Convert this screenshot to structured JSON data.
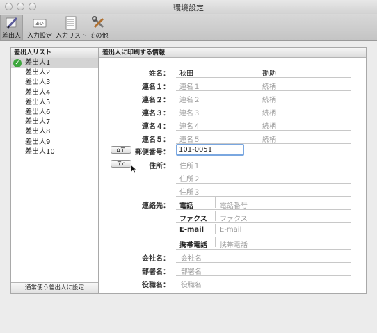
{
  "window": {
    "title": "環境設定"
  },
  "toolbar": {
    "items": [
      {
        "label": "差出人",
        "icon": "pen-icon"
      },
      {
        "label": "入力設定",
        "icon": "keyboard-icon"
      },
      {
        "label": "入力リスト",
        "icon": "list-icon"
      },
      {
        "label": "その他",
        "icon": "tools-icon"
      }
    ]
  },
  "sender_list": {
    "header": "差出人リスト",
    "items": [
      "差出人1",
      "差出人2",
      "差出人3",
      "差出人4",
      "差出人5",
      "差出人6",
      "差出人7",
      "差出人8",
      "差出人9",
      "差出人10"
    ],
    "selected_index": 0,
    "set_default_label": "通常使う差出人に設定"
  },
  "details": {
    "header": "差出人に印刷する情報",
    "name": {
      "label": "姓名：",
      "last": "秋田",
      "first": "勘助"
    },
    "joint": [
      {
        "label": "連名１：",
        "name_placeholder": "連名１",
        "title_placeholder": "続柄"
      },
      {
        "label": "連名２：",
        "name_placeholder": "連名２",
        "title_placeholder": "続柄"
      },
      {
        "label": "連名３：",
        "name_placeholder": "連名３",
        "title_placeholder": "続柄"
      },
      {
        "label": "連名４：",
        "name_placeholder": "連名４",
        "title_placeholder": "続柄"
      },
      {
        "label": "連名５：",
        "name_placeholder": "連名５",
        "title_placeholder": "続柄"
      }
    ],
    "postal": {
      "label": "郵便番号：",
      "value": "101-0051"
    },
    "address": {
      "label": "住所：",
      "placeholders": [
        "住所１",
        "住所２",
        "住所３"
      ]
    },
    "contact": {
      "label": "連絡先：",
      "rows": [
        {
          "type": "電話",
          "placeholder": "電話番号"
        },
        {
          "type": "ファクス",
          "placeholder": "ファクス"
        },
        {
          "type": "E-mail",
          "placeholder": "E-mail"
        },
        {
          "type": "携帯電話",
          "placeholder": "携帯電話"
        }
      ]
    },
    "company": {
      "label": "会社名：",
      "placeholder": "会社名"
    },
    "department": {
      "label": "部署名：",
      "placeholder": "部署名"
    },
    "position": {
      "label": "役職名：",
      "placeholder": "役職名"
    }
  }
}
